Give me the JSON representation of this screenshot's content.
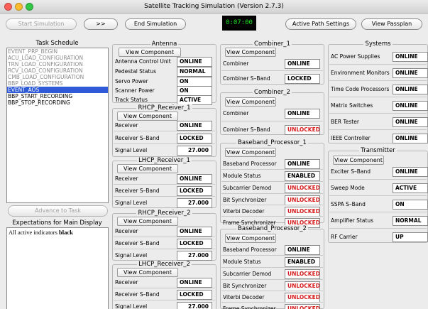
{
  "window": {
    "title": "Satellite Tracking Simulation (Version 2.7.3)",
    "lights": [
      "#fc5f57",
      "#fdbc2e",
      "#33c748"
    ]
  },
  "toolbar": {
    "start": "Start Simulation",
    "step": ">>",
    "end": "End Simulation",
    "timer": "0:07:00",
    "path": "Active Path Settings",
    "passplan": "View Passplan"
  },
  "tasks": {
    "title": "Task Schedule",
    "items": [
      {
        "label": "EVENT_PRP_BEGIN",
        "state": "done"
      },
      {
        "label": "ACU_LOAD_CONFIGURATION",
        "state": "done"
      },
      {
        "label": "TRN_LOAD_CONFIGURATION",
        "state": "done"
      },
      {
        "label": "RCV_LOAD_CONFIGURATION",
        "state": "done"
      },
      {
        "label": "CMB_LOAD_CONFIGURATION",
        "state": "done"
      },
      {
        "label": "BBP_LOAD_SYSTEMS",
        "state": "done"
      },
      {
        "label": "EVENT_AOS",
        "state": "selected"
      },
      {
        "label": "BBP_START_RECORDING",
        "state": "pending"
      },
      {
        "label": "BBP_STOP_RECORDING",
        "state": "pending"
      }
    ],
    "advance": "Advance to Task"
  },
  "expectations": {
    "title": "Expectations for Main Display",
    "prefix": "All active indicators ",
    "emph": "black"
  },
  "view_label": "View Component",
  "antenna": {
    "title": "Antenna",
    "rows": [
      {
        "label": "Antenna Control Unit",
        "value": "ONLINE",
        "color": "black"
      },
      {
        "label": "Pedestal Status",
        "value": "NORMAL",
        "color": "black"
      },
      {
        "label": "Servo Power",
        "value": "ON",
        "color": "black"
      },
      {
        "label": "Scanner Power",
        "value": "ON",
        "color": "black"
      },
      {
        "label": "Track Status",
        "value": "ACTIVE",
        "color": "black"
      }
    ]
  },
  "rhcp1": {
    "title": "RHCP_Receiver_1",
    "rows": [
      {
        "label": "Receiver",
        "value": "ONLINE",
        "color": "black"
      },
      {
        "label": "Receiver S–Band",
        "value": "LOCKED",
        "color": "black"
      },
      {
        "label": "Signal Level",
        "value": "27.000",
        "color": "black"
      }
    ]
  },
  "lhcp1": {
    "title": "LHCP_Receiver_1",
    "rows": [
      {
        "label": "Receiver",
        "value": "ONLINE",
        "color": "black"
      },
      {
        "label": "Receiver S–Band",
        "value": "LOCKED",
        "color": "black"
      },
      {
        "label": "Signal Level",
        "value": "27.000",
        "color": "black"
      }
    ]
  },
  "rhcp2": {
    "title": "RHCP_Receiver_2",
    "rows": [
      {
        "label": "Receiver",
        "value": "ONLINE",
        "color": "black"
      },
      {
        "label": "Receiver S–Band",
        "value": "LOCKED",
        "color": "black"
      },
      {
        "label": "Signal Level",
        "value": "27.000",
        "color": "black"
      }
    ]
  },
  "lhcp2": {
    "title": "LHCP_Receiver_2",
    "rows": [
      {
        "label": "Receiver",
        "value": "ONLINE",
        "color": "black"
      },
      {
        "label": "Receiver S–Band",
        "value": "LOCKED",
        "color": "black"
      },
      {
        "label": "Signal Level",
        "value": "27.000",
        "color": "black"
      }
    ]
  },
  "comb1": {
    "title": "Combiner_1",
    "rows": [
      {
        "label": "Combiner",
        "value": "ONLINE",
        "color": "black"
      },
      {
        "label": "Combiner S–Band",
        "value": "LOCKED",
        "color": "black"
      }
    ]
  },
  "comb2": {
    "title": "Combiner_2",
    "rows": [
      {
        "label": "Combiner",
        "value": "ONLINE",
        "color": "black"
      },
      {
        "label": "Combiner S–Band",
        "value": "UNLOCKED",
        "color": "red"
      }
    ]
  },
  "bbp1": {
    "title": "Baseband_Processor_1",
    "rows": [
      {
        "label": "Baseband Processor",
        "value": "ONLINE",
        "color": "black"
      },
      {
        "label": "Module Status",
        "value": "ENABLED",
        "color": "black"
      },
      {
        "label": "Subcarrier Demod",
        "value": "UNLOCKED",
        "color": "red"
      },
      {
        "label": "Bit Synchronizer",
        "value": "UNLOCKED",
        "color": "red"
      },
      {
        "label": "Viterbi Decoder",
        "value": "UNLOCKED",
        "color": "red"
      },
      {
        "label": "Frame Synchronizer",
        "value": "UNLOCKED",
        "color": "red"
      }
    ]
  },
  "bbp2": {
    "title": "Baseband_Processor_2",
    "rows": [
      {
        "label": "Baseband Processor",
        "value": "ONLINE",
        "color": "black"
      },
      {
        "label": "Module Status",
        "value": "ENABLED",
        "color": "black"
      },
      {
        "label": "Subcarrier Demod",
        "value": "UNLOCKED",
        "color": "red"
      },
      {
        "label": "Bit Synchronizer",
        "value": "UNLOCKED",
        "color": "red"
      },
      {
        "label": "Viterbi Decoder",
        "value": "UNLOCKED",
        "color": "red"
      },
      {
        "label": "Frame Synchronizer",
        "value": "UNLOCKED",
        "color": "red"
      }
    ]
  },
  "systems": {
    "title": "Systems",
    "rows": [
      {
        "label": "AC Power Supplies",
        "value": "ONLINE",
        "color": "black"
      },
      {
        "label": "Environment Monitors",
        "value": "ONLINE",
        "color": "black"
      },
      {
        "label": "Time Code Processors",
        "value": "ONLINE",
        "color": "black"
      },
      {
        "label": "Matrix Switches",
        "value": "ONLINE",
        "color": "black"
      },
      {
        "label": "BER Tester",
        "value": "ONLINE",
        "color": "black"
      },
      {
        "label": "IEEE Controller",
        "value": "ONLINE",
        "color": "black"
      }
    ]
  },
  "transmitter": {
    "title": "Transmitter",
    "rows": [
      {
        "label": "Exciter S–Band",
        "value": "ONLINE",
        "color": "black"
      },
      {
        "label": "Sweep Mode",
        "value": "ACTIVE",
        "color": "black"
      },
      {
        "label": "SSPA S–Band",
        "value": "ON",
        "color": "black"
      },
      {
        "label": "Amplifier Status",
        "value": "NORMAL",
        "color": "black"
      },
      {
        "label": "RF Carrier",
        "value": "UP",
        "color": "black"
      }
    ]
  }
}
